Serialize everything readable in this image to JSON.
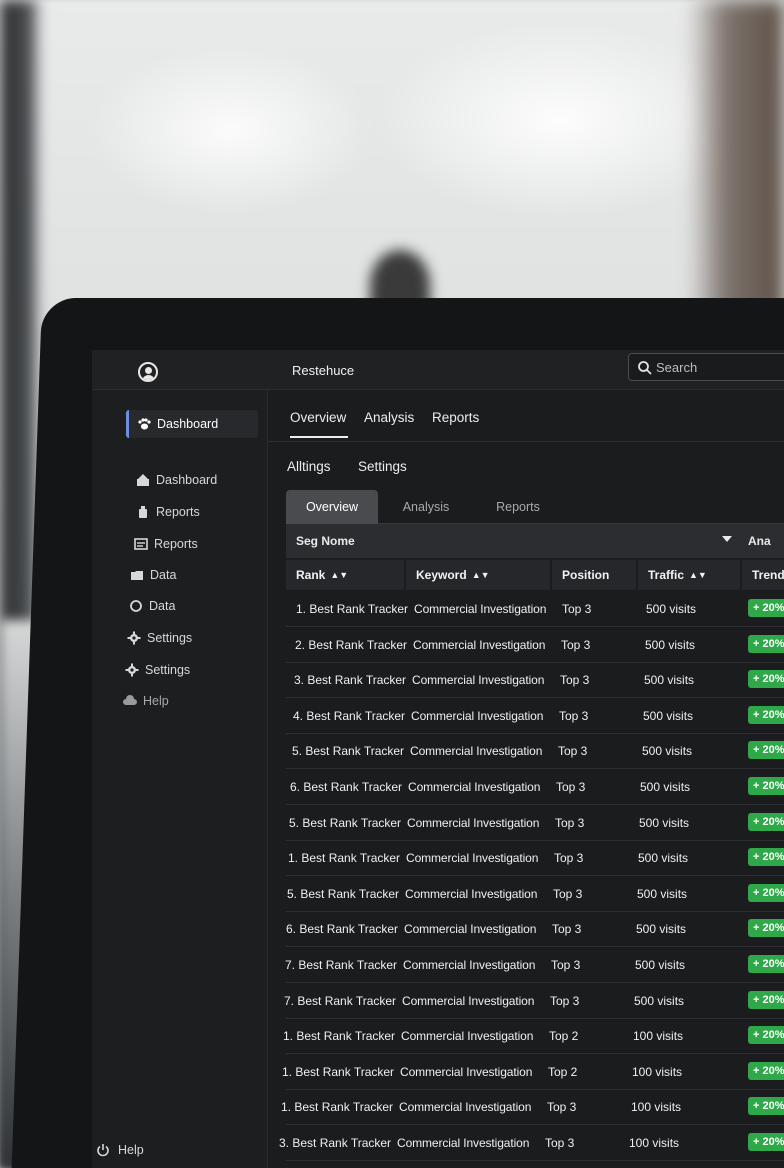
{
  "app": {
    "title": "Restehuce"
  },
  "search": {
    "placeholder": "Search"
  },
  "sidebar": {
    "active": {
      "label": "Dashboard",
      "icon": "paw-icon"
    },
    "items": [
      {
        "label": "Dashboard",
        "icon": "dashboard-icon"
      },
      {
        "label": "Reports",
        "icon": "reports-icon"
      },
      {
        "label": "Reports",
        "icon": "report-window-icon"
      },
      {
        "label": "Data",
        "icon": "folder-icon"
      },
      {
        "label": "Data",
        "icon": "circle-icon"
      },
      {
        "label": "Settings",
        "icon": "gear-icon"
      },
      {
        "label": "Settings",
        "icon": "gear-icon"
      },
      {
        "label": "Help",
        "icon": "cloud-icon"
      }
    ],
    "footer_help": {
      "label": "Help",
      "icon": "power-icon"
    }
  },
  "tabs_primary": [
    "Overview",
    "Analysis",
    "Reports"
  ],
  "tabs_secondary": [
    "Alltings",
    "Settings"
  ],
  "subtabs": [
    "Overview",
    "Analysis",
    "Reports"
  ],
  "segment": {
    "name": "Seg Nome",
    "extra": "Ana"
  },
  "table": {
    "headers": [
      "Rank",
      "Keyword",
      "Position",
      "Traffic",
      "Trend"
    ],
    "rows": [
      {
        "rank": "1. Best Rank Tracker",
        "keyword": "Commercial Investigation",
        "position": "Top 3",
        "traffic": "500 visits",
        "trend": "+ 20%"
      },
      {
        "rank": "2. Best Rank Tracker",
        "keyword": "Commercial Investigation",
        "position": "Top 3",
        "traffic": "500 visits",
        "trend": "+ 20%"
      },
      {
        "rank": "3. Best Rank Tracker",
        "keyword": "Commercial Investigation",
        "position": "Top 3",
        "traffic": "500 visits",
        "trend": "+ 20%"
      },
      {
        "rank": "4. Best Rank Tracker",
        "keyword": "Commercial Investigation",
        "position": "Top 3",
        "traffic": "500 visits",
        "trend": "+ 20%"
      },
      {
        "rank": "5. Best Rank Tracker",
        "keyword": "Commercial Investigation",
        "position": "Top 3",
        "traffic": "500 visits",
        "trend": "+ 20%"
      },
      {
        "rank": "6. Best Rank Tracker",
        "keyword": "Commercial Investigation",
        "position": "Top 3",
        "traffic": "500 visits",
        "trend": "+ 20%"
      },
      {
        "rank": "5. Best Rank Tracker",
        "keyword": "Commercial Investigation",
        "position": "Top 3",
        "traffic": "500 visits",
        "trend": "+ 20%"
      },
      {
        "rank": "1. Best Rank Tracker",
        "keyword": "Commercial Investigation",
        "position": "Top 3",
        "traffic": "500 visits",
        "trend": "+ 20%"
      },
      {
        "rank": "5. Best Rank Tracker",
        "keyword": "Commercial Investigation",
        "position": "Top 3",
        "traffic": "500 visits",
        "trend": "+ 20%"
      },
      {
        "rank": "6. Best Rank Tracker",
        "keyword": "Commercial Investigation",
        "position": "Top 3",
        "traffic": "500 visits",
        "trend": "+ 20%"
      },
      {
        "rank": "7. Best Rank Tracker",
        "keyword": "Commercial Investigation",
        "position": "Top 3",
        "traffic": "500 visits",
        "trend": "+ 20%"
      },
      {
        "rank": "7. Best Rank Tracker",
        "keyword": "Commercial Investigation",
        "position": "Top 3",
        "traffic": "500 visits",
        "trend": "+ 20%"
      },
      {
        "rank": "1. Best Rank Tracker",
        "keyword": "Commercial Investigation",
        "position": "Top 2",
        "traffic": "100 visits",
        "trend": "+ 20%"
      },
      {
        "rank": "1. Best Rank Tracker",
        "keyword": "Commercial Investigation",
        "position": "Top 2",
        "traffic": "100 visits",
        "trend": "+ 20%"
      },
      {
        "rank": "1. Best Rank Tracker",
        "keyword": "Commercial Investigation",
        "position": "Top 3",
        "traffic": "100 visits",
        "trend": "+ 20%"
      },
      {
        "rank": "3. Best Rank Tracker",
        "keyword": "Commercial Investigation",
        "position": "Top 3",
        "traffic": "100 visits",
        "trend": "+ 20%"
      }
    ]
  },
  "colors": {
    "accent": "#6d8fe0",
    "trend_badge": "#2fa84a",
    "screen_bg": "#1b1c1e"
  }
}
